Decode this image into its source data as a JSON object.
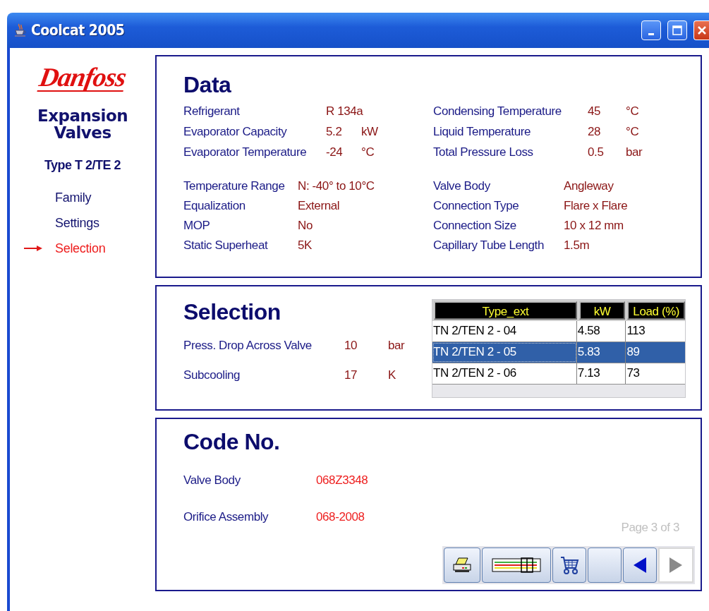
{
  "window": {
    "title": "Coolcat 2005"
  },
  "sidebar": {
    "logo": "Danfoss",
    "heading": "Expansion Valves",
    "subheading": "Type T 2/TE 2",
    "items": [
      {
        "label": "Family",
        "selected": false
      },
      {
        "label": "Settings",
        "selected": false
      },
      {
        "label": "Selection",
        "selected": true
      }
    ]
  },
  "data": {
    "title": "Data",
    "groups": [
      {
        "rows": [
          {
            "label": "Refrigerant",
            "value": "R 134a"
          },
          {
            "label": "Evaporator Capacity",
            "value": "5.2",
            "unit": "kW"
          },
          {
            "label": "Evaporator Temperature",
            "value": "-24",
            "unit": "°C"
          }
        ]
      },
      {
        "rows": [
          {
            "label": "Condensing Temperature",
            "value": "45",
            "unit": "°C"
          },
          {
            "label": "Liquid Temperature",
            "value": "28",
            "unit": "°C"
          },
          {
            "label": "Total Pressure Loss",
            "value": "0.5",
            "unit": "bar"
          }
        ]
      },
      {
        "rows": [
          {
            "label": "Temperature Range",
            "value": "N: -40° to 10°C"
          },
          {
            "label": "Equalization",
            "value": "External"
          },
          {
            "label": "MOP",
            "value": "No"
          },
          {
            "label": "Static Superheat",
            "value": "5K"
          }
        ]
      },
      {
        "rows": [
          {
            "label": "Valve Body",
            "value": "Angleway"
          },
          {
            "label": "Connection Type",
            "value": "Flare x Flare"
          },
          {
            "label": "Connection Size",
            "value": "10 x 12 mm"
          },
          {
            "label": "Capillary Tube Length",
            "value": "1.5m"
          }
        ]
      }
    ]
  },
  "selection": {
    "title": "Selection",
    "params": [
      {
        "label": "Press. Drop Across Valve",
        "value": "10",
        "unit": "bar"
      },
      {
        "label": "Subcooling",
        "value": "17",
        "unit": "K"
      }
    ],
    "table": {
      "columns": [
        "Type_ext",
        "kW",
        "Load (%)"
      ],
      "rows": [
        {
          "cells": [
            "TN 2/TEN 2 - 04",
            "4.58",
            "113"
          ],
          "selected": false
        },
        {
          "cells": [
            "TN 2/TEN 2 - 05",
            "5.83",
            "89"
          ],
          "selected": true
        },
        {
          "cells": [
            "TN 2/TEN 2 - 06",
            "7.13",
            "73"
          ],
          "selected": false
        }
      ]
    }
  },
  "code": {
    "title": "Code No.",
    "rows": [
      {
        "label": "Valve Body",
        "value": "068Z3348"
      },
      {
        "label": "Orifice Assembly",
        "value": "068-2008"
      }
    ],
    "page": "Page 3 of 3"
  },
  "toolbar": [
    {
      "kind": "print",
      "disabled": false
    },
    {
      "kind": "gauge",
      "disabled": false
    },
    {
      "kind": "cart",
      "disabled": false
    },
    {
      "kind": "blank",
      "disabled": false
    },
    {
      "kind": "prev",
      "disabled": false
    },
    {
      "kind": "next",
      "disabled": true
    }
  ]
}
